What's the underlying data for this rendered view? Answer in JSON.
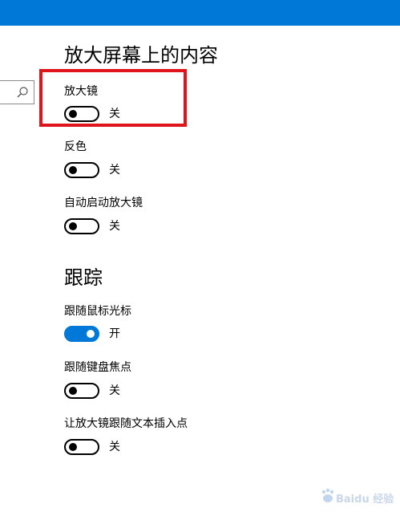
{
  "colors": {
    "accent": "#0078d7",
    "highlight": "#e0141b",
    "toggle_off_border": "#000000"
  },
  "sections": {
    "magnify": {
      "title": "放大屏幕上的内容",
      "settings": [
        {
          "label": "放大镜",
          "state": "关",
          "on": false
        },
        {
          "label": "反色",
          "state": "关",
          "on": false
        },
        {
          "label": "自动启动放大镜",
          "state": "关",
          "on": false
        }
      ]
    },
    "tracking": {
      "title": "跟踪",
      "settings": [
        {
          "label": "跟随鼠标光标",
          "state": "开",
          "on": true
        },
        {
          "label": "跟随键盘焦点",
          "state": "关",
          "on": false
        },
        {
          "label": "让放大镜跟随文本插入点",
          "state": "关",
          "on": false
        }
      ]
    }
  },
  "icons": {
    "search": "search-icon",
    "watermark": "baidu-jingyan-logo"
  },
  "watermark": {
    "text": "Baidu 经验"
  }
}
